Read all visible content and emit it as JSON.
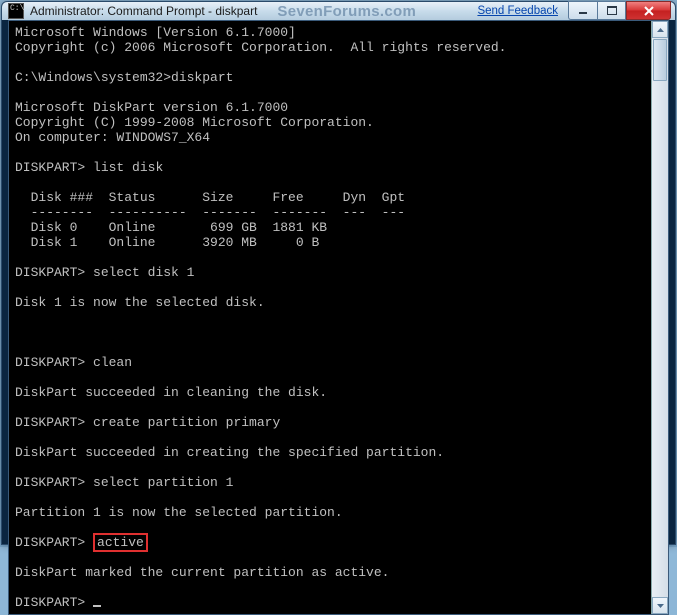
{
  "titlebar": {
    "icon": "cmd-icon",
    "title": "Administrator: Command Prompt - diskpart",
    "watermark": "SevenForums.com",
    "feedback": "Send Feedback"
  },
  "console": {
    "header1": "Microsoft Windows [Version 6.1.7000]",
    "header2": "Copyright (c) 2006 Microsoft Corporation.  All rights reserved.",
    "prompt_cmd": "C:\\Windows\\system32>",
    "cmd1": "diskpart",
    "dp1": "Microsoft DiskPart version 6.1.7000",
    "dp2": "Copyright (C) 1999-2008 Microsoft Corporation.",
    "dp3": "On computer: WINDOWS7_X64",
    "dp_prompt": "DISKPART>",
    "cmd_list": "list disk",
    "tbl_hdr": "  Disk ###  Status      Size     Free     Dyn  Gpt",
    "tbl_sep": "  --------  ----------  -------  -------  ---  ---",
    "tbl_r0": "  Disk 0    Online       699 GB  1881 KB",
    "tbl_r1": "  Disk 1    Online      3920 MB     0 B",
    "cmd_sel_disk": "select disk 1",
    "msg_sel_disk": "Disk 1 is now the selected disk.",
    "cmd_clean": "clean",
    "msg_clean": "DiskPart succeeded in cleaning the disk.",
    "cmd_create": "create partition primary",
    "msg_create": "DiskPart succeeded in creating the specified partition.",
    "cmd_sel_part": "select partition 1",
    "msg_sel_part": "Partition 1 is now the selected partition.",
    "cmd_active": "active",
    "msg_active": "DiskPart marked the current partition as active."
  }
}
